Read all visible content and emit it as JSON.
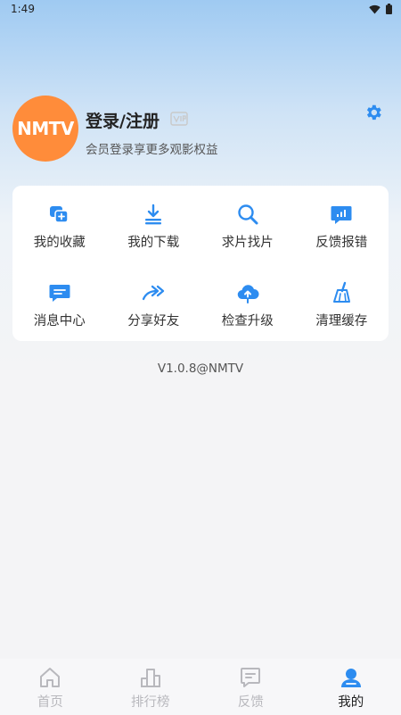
{
  "status_bar": {
    "time": "1:49"
  },
  "profile": {
    "avatar_text": "NMTV",
    "login_title": "登录/注册",
    "subtitle": "会员登录享更多观影权益"
  },
  "menu": {
    "items": [
      {
        "label": "我的收藏",
        "icon": "favorites-icon"
      },
      {
        "label": "我的下载",
        "icon": "download-icon"
      },
      {
        "label": "求片找片",
        "icon": "search-icon"
      },
      {
        "label": "反馈报错",
        "icon": "feedback-icon"
      },
      {
        "label": "消息中心",
        "icon": "message-icon"
      },
      {
        "label": "分享好友",
        "icon": "share-icon"
      },
      {
        "label": "检查升级",
        "icon": "upgrade-icon"
      },
      {
        "label": "清理缓存",
        "icon": "broom-icon"
      }
    ]
  },
  "version": "V1.0.8@NMTV",
  "tabbar": {
    "tabs": [
      {
        "label": "首页",
        "icon": "home-icon"
      },
      {
        "label": "排行榜",
        "icon": "ranking-icon"
      },
      {
        "label": "反馈",
        "icon": "feedback-tab-icon"
      },
      {
        "label": "我的",
        "icon": "profile-icon",
        "active": true
      }
    ]
  },
  "colors": {
    "accent": "#2d8cf0",
    "avatar_bg": "#ff8c3a",
    "tab_inactive": "#b8b8bd"
  }
}
